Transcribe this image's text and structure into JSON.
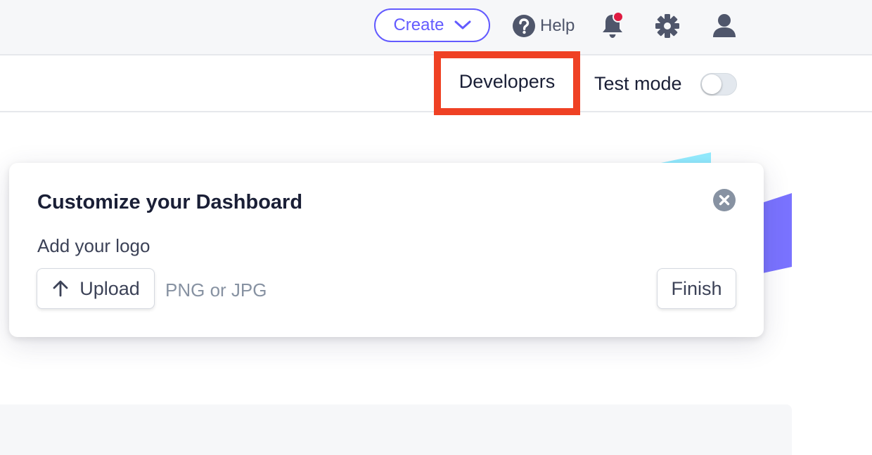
{
  "colors": {
    "accent": "#635bff",
    "highlight": "#ef4124",
    "notification_dot": "#df1b41",
    "icon": "#4f566b"
  },
  "topbar": {
    "create_label": "Create",
    "help_label": "Help",
    "icons": [
      "chevron-down-icon",
      "help-icon",
      "bell-icon",
      "gear-icon",
      "user-icon"
    ]
  },
  "subheader": {
    "developers_label": "Developers",
    "test_mode_label": "Test mode",
    "test_mode_on": false
  },
  "card": {
    "title": "Customize your Dashboard",
    "logo_label": "Add your logo",
    "upload_label": "Upload",
    "file_hint": "PNG or JPG",
    "finish_label": "Finish"
  }
}
